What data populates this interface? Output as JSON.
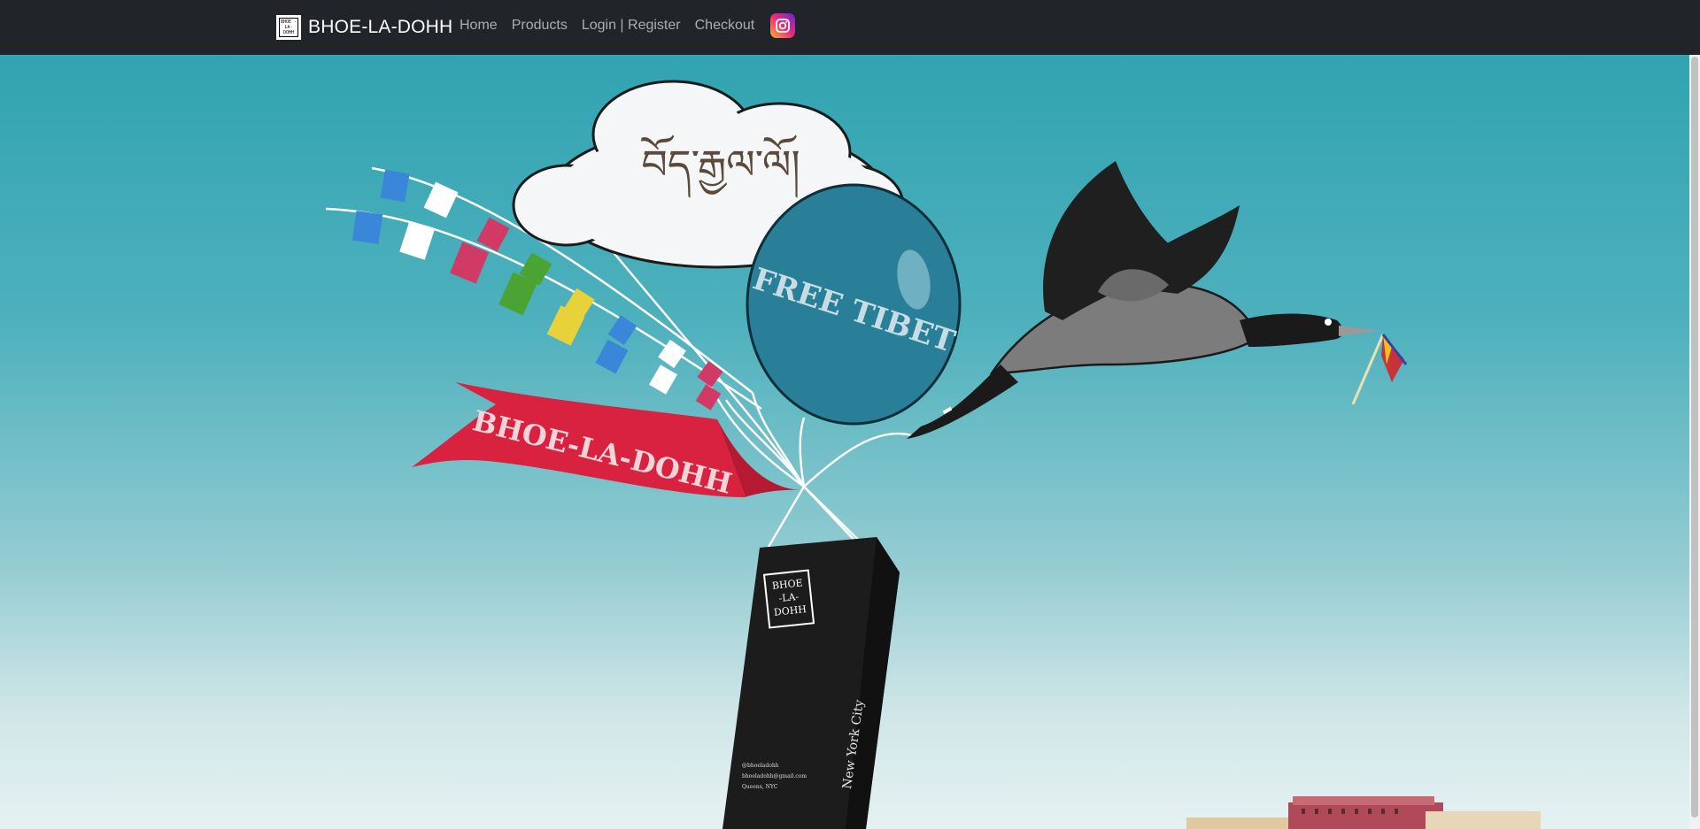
{
  "navbar": {
    "brand_logo_text": "BHOE -LA- DOHH",
    "brand_name": "BHOE-LA-DOHH",
    "links": [
      {
        "label": "Home"
      },
      {
        "label": "Products"
      },
      {
        "label": "Login | Register"
      },
      {
        "label": "Checkout"
      }
    ],
    "instagram_icon": "instagram-icon"
  },
  "hero": {
    "cloud_text": "བོད་རྒྱལ་ལོ།",
    "balloon_text": "FREE TIBET",
    "banner_text": "BHOE-LA-DOHH",
    "bag_logo_lines": [
      "BHOE",
      "-LA-",
      "DOHH"
    ],
    "bag_city": "New York City",
    "bag_contacts": [
      "@bhoeladohh",
      "bhoeladohh@gmail.com",
      "Queens, NYC"
    ]
  },
  "colors": {
    "navbar_bg": "#212529",
    "sky_top": "#32a3b1",
    "sky_bottom": "#e6f1f1",
    "balloon": "#2a7f98",
    "banner": "#d8223f"
  }
}
